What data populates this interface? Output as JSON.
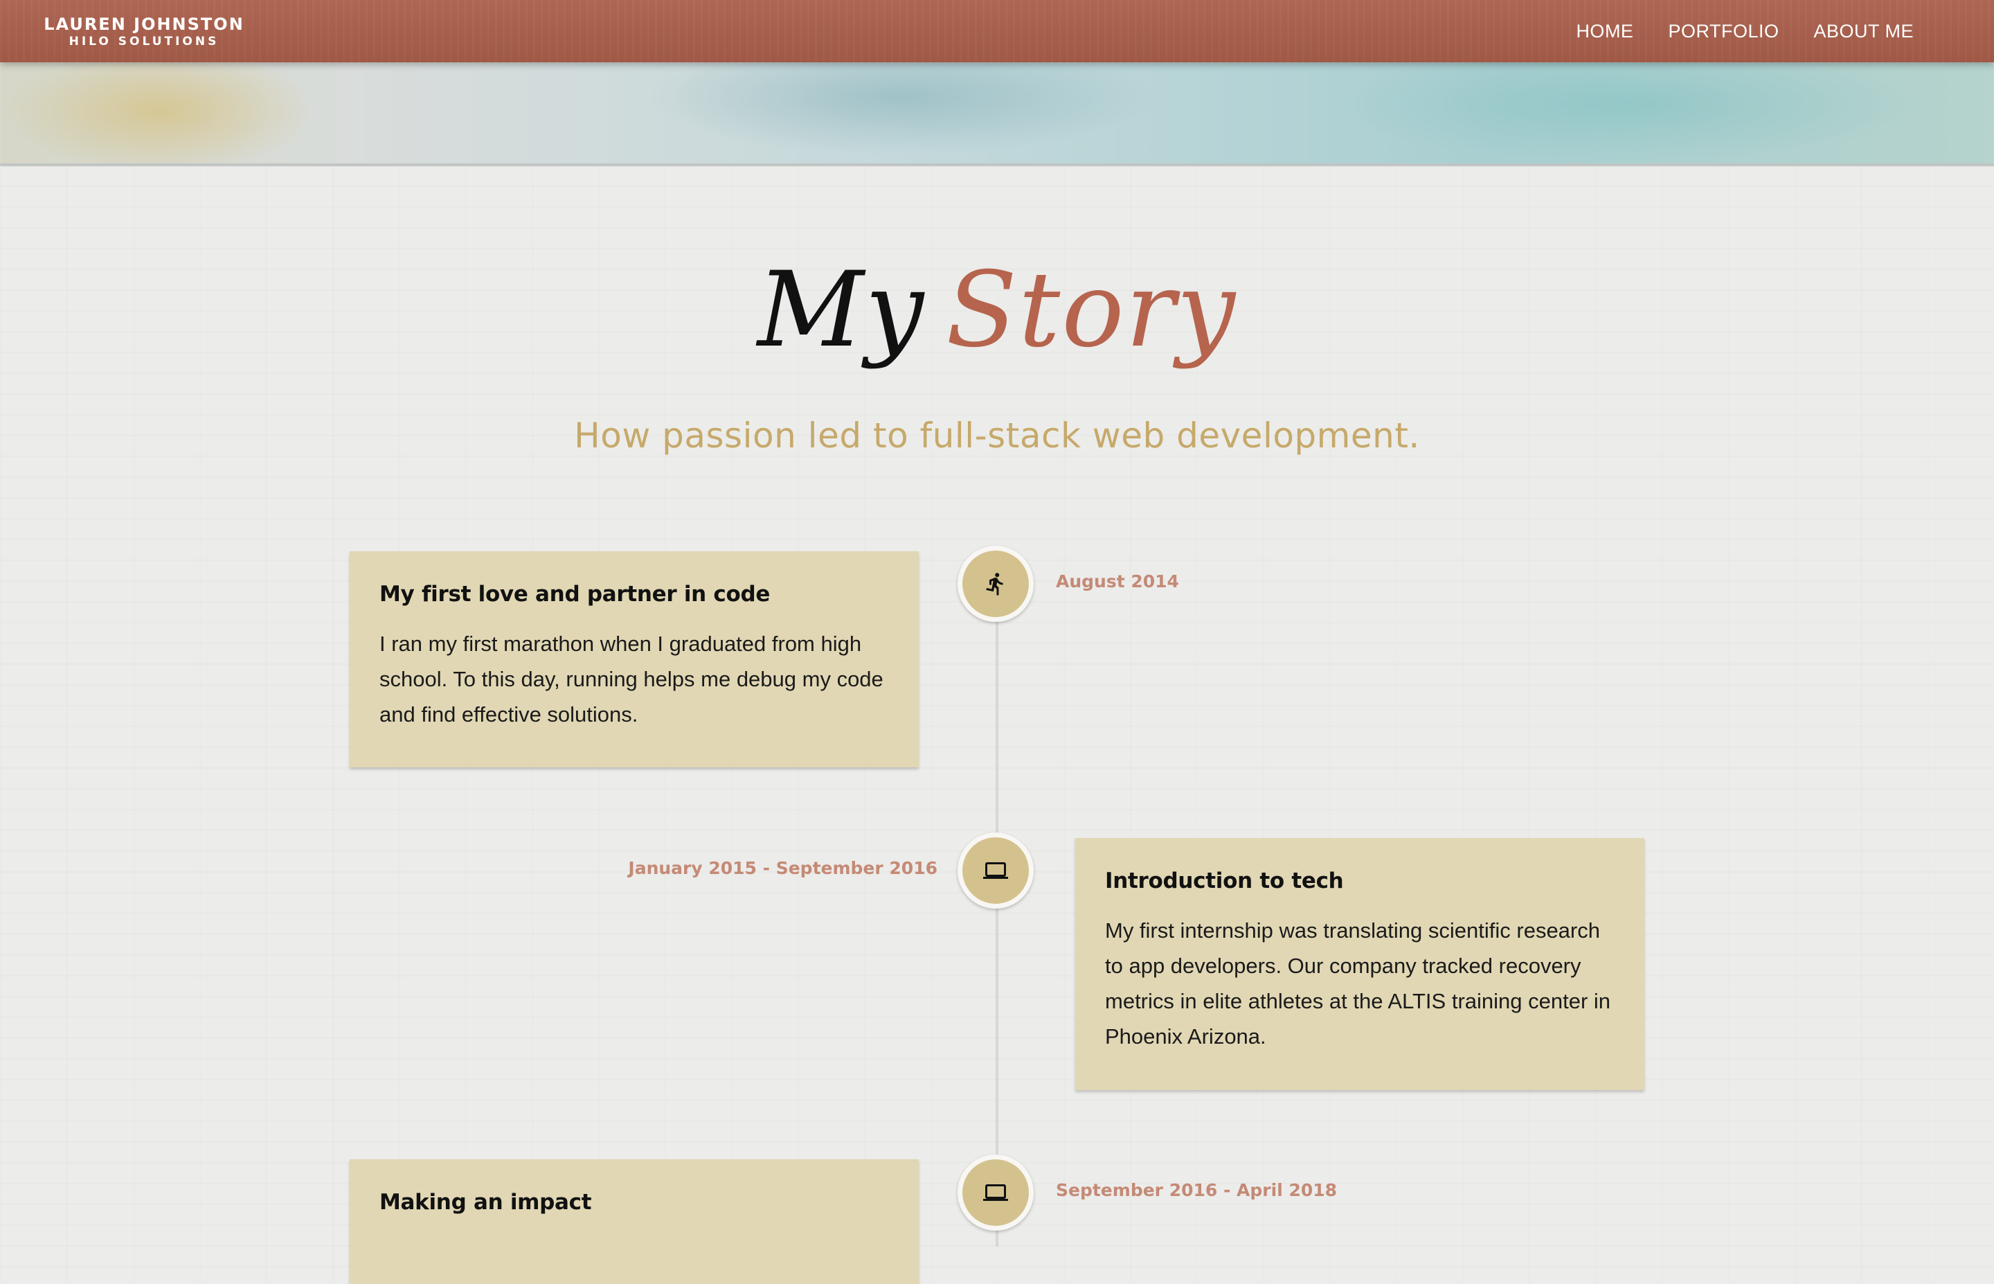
{
  "nav": {
    "brand_name": "LAUREN JOHNSTON",
    "brand_sub": "HILO SOLUTIONS",
    "links": [
      {
        "label": "HOME"
      },
      {
        "label": "PORTFOLIO"
      },
      {
        "label": "ABOUT ME"
      }
    ]
  },
  "hero": {
    "title_part1": "My",
    "title_part2": "Story",
    "subtitle": "How passion led to full-stack web development."
  },
  "timeline": [
    {
      "title": "My first love and partner in code",
      "text": "I ran my first marathon when I graduated from high school. To this day, running helps me debug my code and find effective solutions.",
      "date": "August 2014",
      "icon": "running-icon"
    },
    {
      "title": "Introduction to tech",
      "text": "My first internship was translating scientific research to app developers. Our company tracked recovery metrics in elite athletes at the ALTIS training center in Phoenix Arizona.",
      "date": "January 2015 - September 2016",
      "icon": "laptop-icon"
    },
    {
      "title": "Making an impact",
      "text": "",
      "date": "September 2016 - April 2018",
      "icon": "laptop-icon"
    }
  ],
  "colors": {
    "nav_bg": "#a95e4a",
    "accent_title": "#b6644e",
    "subtitle": "#c6a96a",
    "card_bg": "#e1d7b4",
    "marker_bg": "#d4c28e",
    "date": "#c48a76"
  }
}
